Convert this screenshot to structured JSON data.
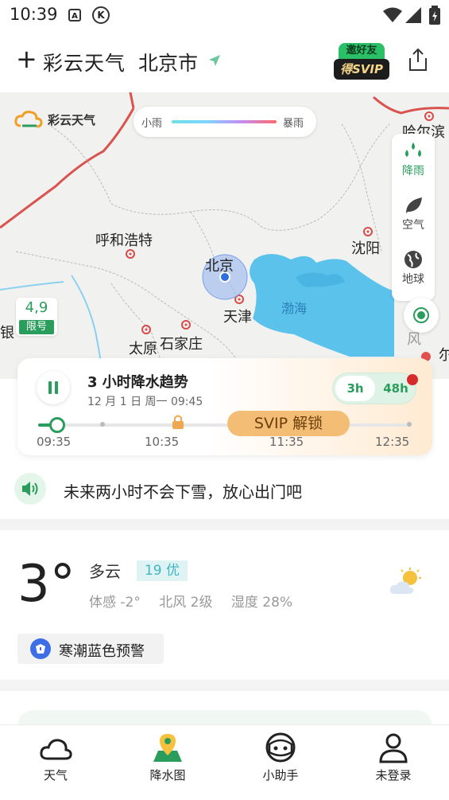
{
  "status_bar": {
    "time": "10:39",
    "icon_a": "A",
    "icon_k": "K"
  },
  "header": {
    "plus": "+",
    "app_title": "彩云天气",
    "city": "北京市",
    "svip_top": "邀好友",
    "svip_bottom": "得SVIP"
  },
  "map": {
    "logo_text": "彩云天气",
    "legend_min": "小雨",
    "legend_max": "暴雨",
    "labels": {
      "harbin": "哈尔滨",
      "hohhot": "呼和浩特",
      "shenyang": "沈阳",
      "beijing": "北京",
      "tianjin": "天津",
      "bohai": "渤海",
      "taiyuan": "太原",
      "shijiazhuang": "石家庄",
      "yin": "银",
      "fang": "风",
      "right_edge": "尔"
    },
    "layers": [
      {
        "label": "降雨",
        "icon": "rain-drops-icon",
        "active": true
      },
      {
        "label": "空气",
        "icon": "leaf-icon",
        "active": false
      },
      {
        "label": "地球",
        "icon": "globe-icon",
        "active": false
      }
    ],
    "plate": {
      "numbers": "4,9",
      "tag": "限号"
    }
  },
  "precip_card": {
    "title": "3 小时降水趋势",
    "date": "12 月 1 日 周一 09:45",
    "range_3h": "3h",
    "range_48h": "48h",
    "unlock": "SVIP 解锁",
    "times": [
      "09:35",
      "10:35",
      "11:35",
      "12:35"
    ]
  },
  "alert": {
    "text": "未来两小时不会下雪，放心出门吧"
  },
  "current": {
    "temp": "3°",
    "condition": "多云",
    "aqi": "19 优",
    "feels_like": "体感 -2°",
    "wind": "北风 2级",
    "humidity": "湿度 28%"
  },
  "warning": {
    "text": "寒潮蓝色预警"
  },
  "tabs": [
    {
      "label": "天气",
      "icon": "cloud-icon",
      "active": false
    },
    {
      "label": "降水图",
      "icon": "map-pin-icon",
      "active": true
    },
    {
      "label": "小助手",
      "icon": "assistant-icon",
      "active": false
    },
    {
      "label": "未登录",
      "icon": "user-icon",
      "active": false
    }
  ],
  "colors": {
    "accent": "#2a9d5c",
    "border_red": "#d9534f",
    "sea": "#5bc2ec",
    "svip_gold": "#f3bd76"
  }
}
